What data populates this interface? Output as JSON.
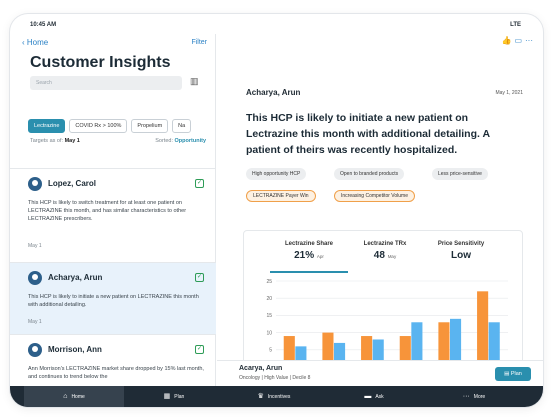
{
  "status": {
    "time": "10:45 AM",
    "signal": "LTE"
  },
  "nav": {
    "back_label": "Home",
    "filter_label": "Filter"
  },
  "left": {
    "title": "Customer Insights",
    "search_placeholder": "Search",
    "chips": [
      "Lectrazine",
      "COVID Rx > 100%",
      "Propelium",
      "Na"
    ],
    "targets_label": "Targets as of:",
    "targets_date": "May 1",
    "sorted_label": "Sorted:",
    "sorted_value": "Opportunity",
    "items": [
      {
        "name": "Lopez, Carol",
        "text": "This HCP is likely to switch treatment for at least one patient on LECTRAZINE this month, and has similar characteristics to other LECTRAZINE prescribers.",
        "date": "May 1"
      },
      {
        "name": "Acharya, Arun",
        "text": "This HCP is likely to initiate a new patient on LECTRAZINE this month with additional detailing.",
        "date": "May 1"
      },
      {
        "name": "Morrison, Ann",
        "text": "Ann Morrison's LECTRAZINE market share dropped by 15% last month, and continues to trend below the",
        "date": ""
      }
    ]
  },
  "right": {
    "name": "Acharya, Arun",
    "date": "May 1, 2021",
    "insight": "This HCP is likely to initiate a new patient on Lectrazine this month with additional detailing. A patient of theirs was recently hospitalized.",
    "tags": [
      "High opportunity HCP",
      "Open to branded products",
      "Less price-sensitive"
    ],
    "warn_tags": [
      "LECTRAZINE Payer Win",
      "Increasing Competitor Volume"
    ],
    "kpis": [
      {
        "label": "Lectrazine Share",
        "value": "21%",
        "unit": "Apr"
      },
      {
        "label": "Lectrazine TRx",
        "value": "48",
        "unit": "May"
      },
      {
        "label": "Price Sensitivity",
        "value": "Low",
        "unit": ""
      }
    ]
  },
  "chart_data": {
    "type": "bar",
    "categories": [
      "Nov",
      "Dec",
      "Jan",
      "Feb",
      "Mar",
      "Apr"
    ],
    "series": [
      {
        "values": [
          9,
          10,
          9,
          9,
          13,
          22
        ],
        "color": "#f7943a"
      },
      {
        "values": [
          6,
          7,
          8,
          13,
          14,
          13
        ],
        "color": "#5ab4f0"
      }
    ],
    "ylim": [
      0,
      25
    ],
    "yticks": [
      0,
      5,
      10,
      15,
      20,
      25
    ],
    "grid": true
  },
  "bottom": {
    "name": "Acarya, Arun",
    "sub": "Oncology | High Value | Decile 8",
    "plan_label": "Plan"
  },
  "tabs": [
    {
      "label": "Home",
      "active": true
    },
    {
      "label": "Plan",
      "active": false
    },
    {
      "label": "Incentives",
      "active": false
    },
    {
      "label": "Ask",
      "active": false
    },
    {
      "label": "More",
      "active": false
    }
  ]
}
